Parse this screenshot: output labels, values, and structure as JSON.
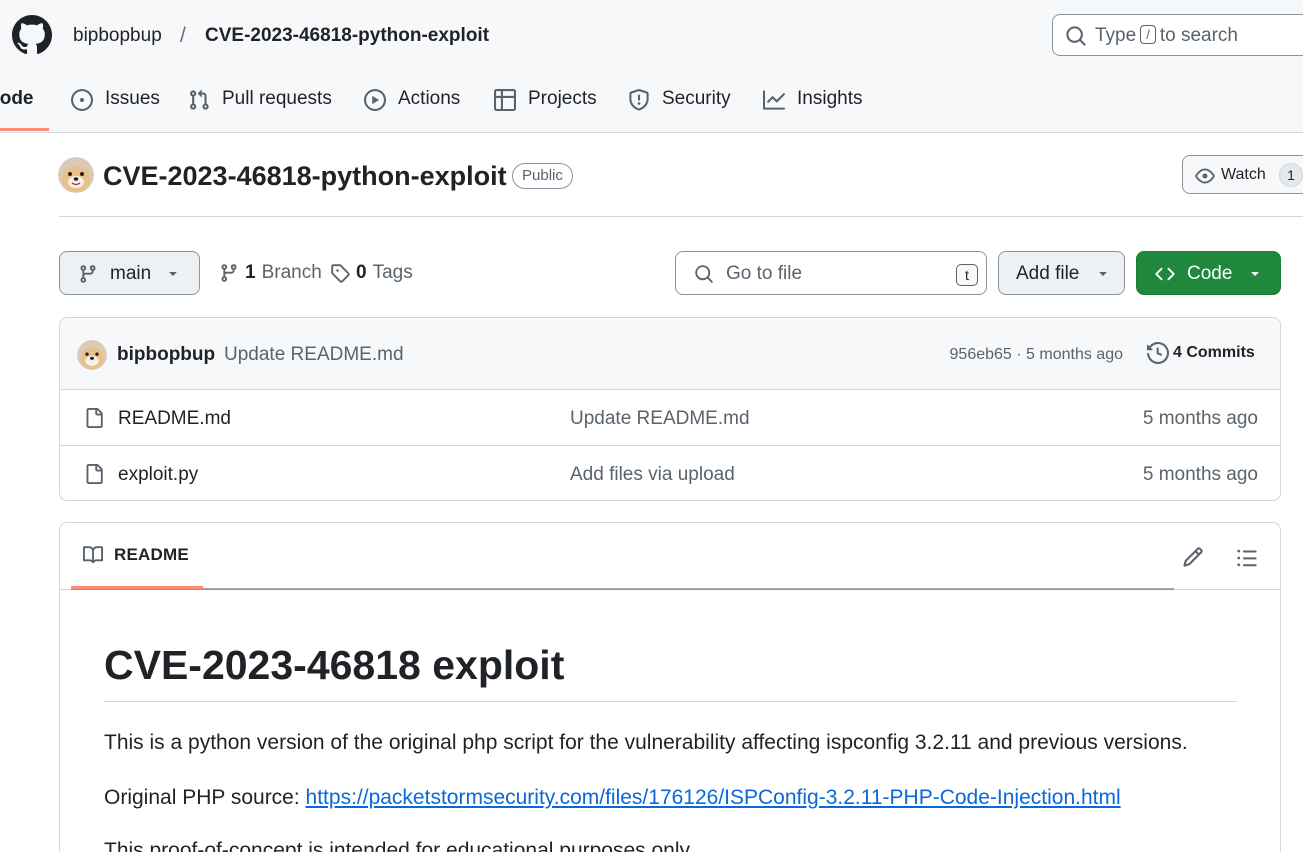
{
  "header": {
    "owner": "bipbopbup",
    "separator": "/",
    "repo": "CVE-2023-46818-python-exploit",
    "search": {
      "prefix": "Type",
      "key": "/",
      "suffix": "to search"
    }
  },
  "nav": {
    "tabs": [
      {
        "id": "code",
        "label": "Code",
        "icon": "code-icon",
        "active": true
      },
      {
        "id": "issues",
        "label": "Issues",
        "icon": "issue-icon"
      },
      {
        "id": "pull-requests",
        "label": "Pull requests",
        "icon": "pull-request-icon"
      },
      {
        "id": "actions",
        "label": "Actions",
        "icon": "play-icon"
      },
      {
        "id": "projects",
        "label": "Projects",
        "icon": "table-icon"
      },
      {
        "id": "security",
        "label": "Security",
        "icon": "shield-icon"
      },
      {
        "id": "insights",
        "label": "Insights",
        "icon": "graph-icon"
      }
    ]
  },
  "repo": {
    "title": "CVE-2023-46818-python-exploit",
    "visibility": "Public",
    "watch_label": "Watch",
    "watch_count": "1"
  },
  "toolbar": {
    "branch": "main",
    "branch_count": "1",
    "branch_label": "Branch",
    "tag_count": "0",
    "tag_label": "Tags",
    "goto_placeholder": "Go to file",
    "goto_key": "t",
    "add_file": "Add file",
    "code": "Code"
  },
  "latest_commit": {
    "author": "bipbopbup",
    "message": "Update README.md",
    "sha_age": "956eb65 · 5 months ago",
    "commits": "4 Commits"
  },
  "files": [
    {
      "name": "README.md",
      "message": "Update README.md",
      "age": "5 months ago"
    },
    {
      "name": "exploit.py",
      "message": "Add files via upload",
      "age": "5 months ago"
    }
  ],
  "readme": {
    "tab_label": "README",
    "h1": "CVE-2023-46818 exploit",
    "p1": "This is a python version of the original php script for the vulnerability affecting ispconfig 3.2.11 and previous versions.",
    "p2_prefix": "Original PHP source:",
    "p2_link": "https://packetstormsecurity.com/files/176126/ISPConfig-3.2.11-PHP-Code-Injection.html",
    "p3": "This proof-of-concept is intended for educational purposes only."
  },
  "colors": {
    "accent_underline": "#fd8c73",
    "primary_button": "#1f883d",
    "link": "#0969da"
  }
}
